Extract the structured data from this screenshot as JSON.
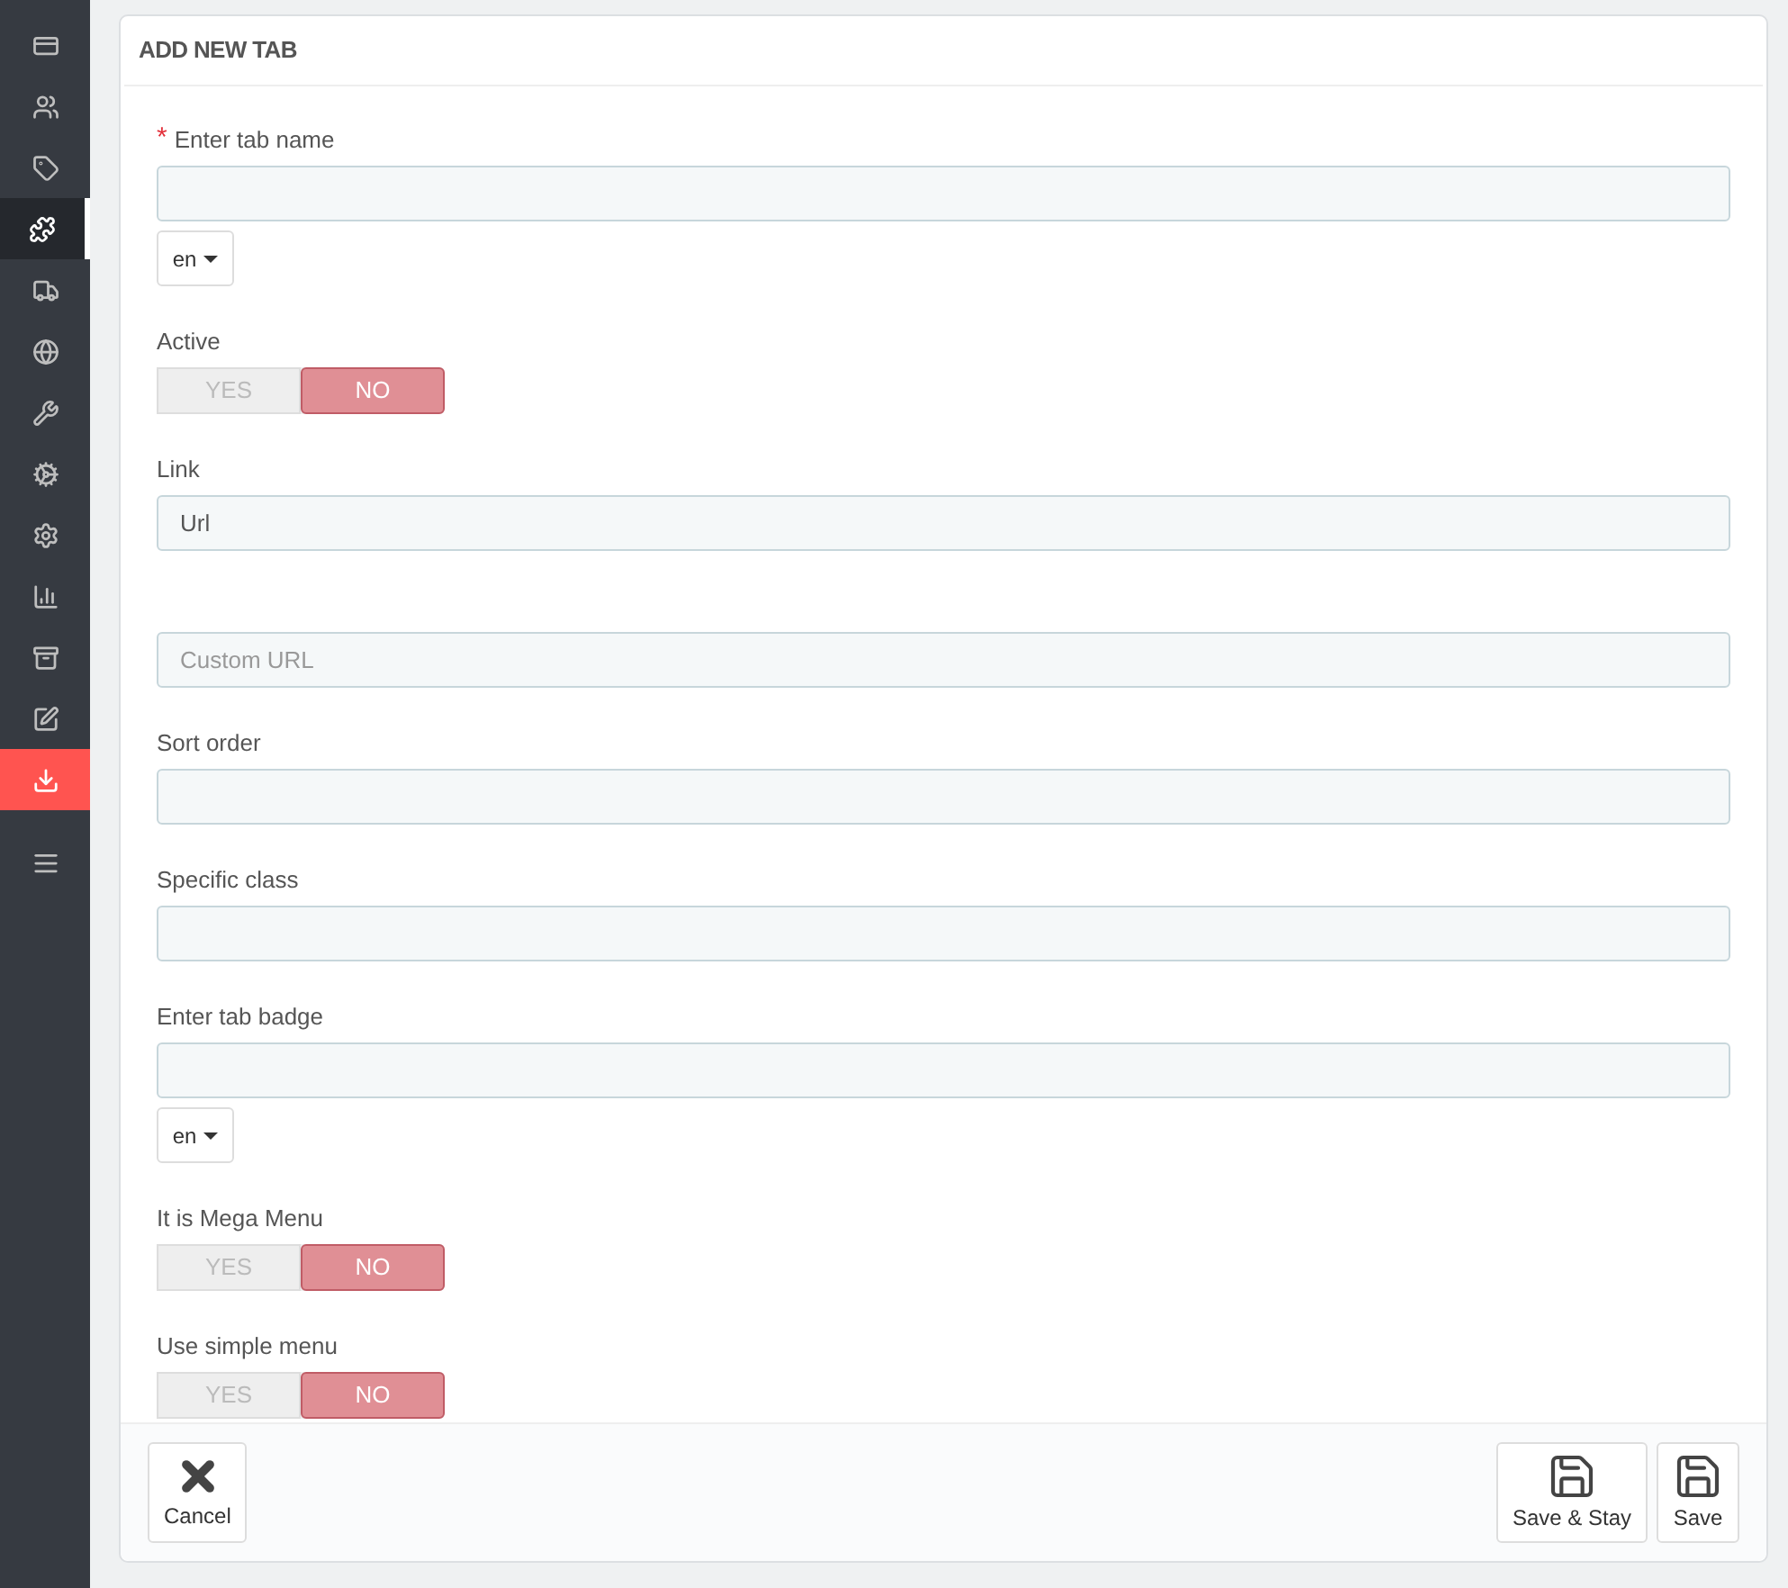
{
  "sidebar": {
    "items": [
      {
        "kind": "card",
        "selected": false,
        "highlighted": false
      },
      {
        "kind": "users",
        "selected": false,
        "highlighted": false
      },
      {
        "kind": "tag",
        "selected": false,
        "highlighted": false
      },
      {
        "kind": "puzzle",
        "selected": true,
        "highlighted": false
      },
      {
        "kind": "truck",
        "selected": false,
        "highlighted": false
      },
      {
        "kind": "globe",
        "selected": false,
        "highlighted": false
      },
      {
        "kind": "wrench",
        "selected": false,
        "highlighted": false
      },
      {
        "kind": "cogs",
        "selected": false,
        "highlighted": false
      },
      {
        "kind": "cog",
        "selected": false,
        "highlighted": false
      },
      {
        "kind": "chart",
        "selected": false,
        "highlighted": false
      },
      {
        "kind": "archive",
        "selected": false,
        "highlighted": false
      },
      {
        "kind": "edit",
        "selected": false,
        "highlighted": false
      },
      {
        "kind": "download",
        "selected": false,
        "highlighted": true
      },
      {
        "kind": "menu",
        "selected": false,
        "highlighted": false
      }
    ]
  },
  "panel": {
    "title": "ADD NEW TAB",
    "fields": [
      {
        "kind": "text",
        "label": "Enter tab name",
        "required_mark": "*",
        "language": "en"
      },
      {
        "kind": "toggle",
        "label": "Active",
        "options": [
          {
            "label": "YES",
            "selected": false
          },
          {
            "label": "NO",
            "selected": true
          }
        ]
      },
      {
        "kind": "text",
        "label": "Link",
        "value": "Url"
      },
      {
        "kind": "text",
        "placeholder": "Custom URL"
      },
      {
        "kind": "text",
        "label": "Sort order"
      },
      {
        "kind": "text",
        "label": "Specific class"
      },
      {
        "kind": "text",
        "label": "Enter tab badge",
        "language": "en"
      },
      {
        "kind": "toggle",
        "label": "It is Mega Menu",
        "options": [
          {
            "label": "YES",
            "selected": false
          },
          {
            "label": "NO",
            "selected": true
          }
        ]
      },
      {
        "kind": "toggle",
        "label": "Use simple menu",
        "options": [
          {
            "label": "YES",
            "selected": false
          },
          {
            "label": "NO",
            "selected": true
          }
        ]
      }
    ],
    "footer": {
      "left": [
        {
          "kind": "cancel",
          "label": "Cancel"
        }
      ],
      "right": [
        {
          "kind": "save",
          "label": "Save & Stay"
        },
        {
          "kind": "save",
          "label": "Save"
        }
      ]
    }
  }
}
